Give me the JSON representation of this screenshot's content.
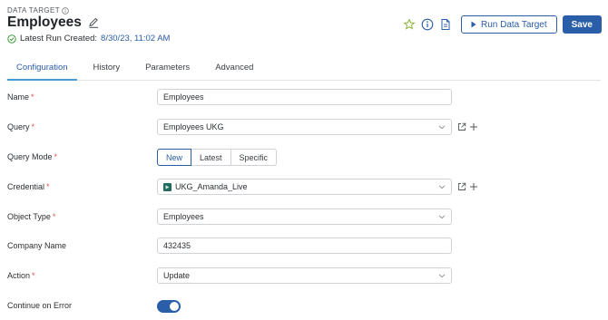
{
  "header": {
    "kicker": "DATA TARGET",
    "title": "Employees",
    "run_prefix": "Latest Run Created:",
    "run_timestamp": "8/30/23, 11:02 AM"
  },
  "toolbar": {
    "run_label": "Run Data Target",
    "save_label": "Save"
  },
  "tabs": [
    "Configuration",
    "History",
    "Parameters",
    "Advanced"
  ],
  "active_tab": "Configuration",
  "form": {
    "name": {
      "label": "Name",
      "value": "Employees",
      "required": true
    },
    "query": {
      "label": "Query",
      "value": "Employees UKG",
      "required": true
    },
    "query_mode": {
      "label": "Query Mode",
      "options": [
        "New",
        "Latest",
        "Specific"
      ],
      "selected": "New",
      "required": true
    },
    "credential": {
      "label": "Credential",
      "value": "UKG_Amanda_Live",
      "required": true
    },
    "object_type": {
      "label": "Object Type",
      "value": "Employees",
      "required": true
    },
    "company_name": {
      "label": "Company Name",
      "value": "432435",
      "required": false
    },
    "action": {
      "label": "Action",
      "value": "Update",
      "required": true
    },
    "continue_on_error": {
      "label": "Continue on Error",
      "enabled": true
    }
  },
  "colors": {
    "accent": "#2a5ea8",
    "required": "#d9534f",
    "success": "#3c9a3c",
    "star": "#8fb03a",
    "tab_underline": "#4a9cd6"
  }
}
